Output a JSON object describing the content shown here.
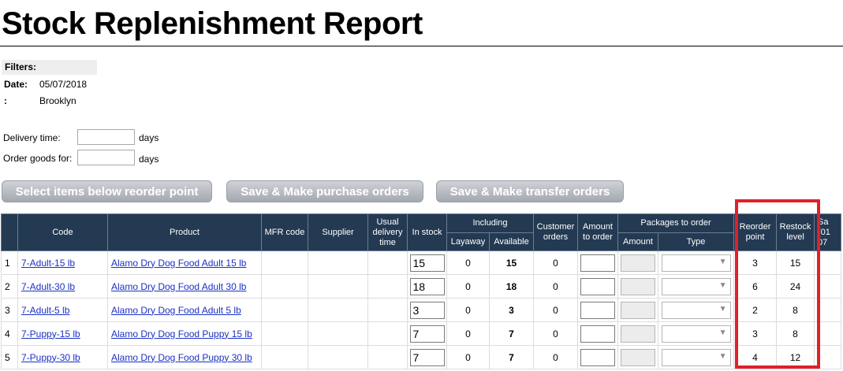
{
  "page_title": "Stock Replenishment Report",
  "filters": {
    "heading": "Filters:",
    "date_label": "Date:",
    "date_value": "05/07/2018",
    "location_label": ":",
    "location_value": "Brooklyn"
  },
  "options": {
    "delivery_label": "Delivery time:",
    "delivery_unit": "days",
    "order_label": "Order goods for:",
    "order_unit": "days"
  },
  "buttons": {
    "select_below": "Select items below reorder point",
    "purchase": "Save & Make purchase orders",
    "transfer": "Save & Make transfer orders"
  },
  "table": {
    "headers": {
      "code": "Code",
      "product": "Product",
      "mfr": "MFR code",
      "supplier": "Supplier",
      "usual_delivery": "Usual delivery time",
      "in_stock": "In stock",
      "including": "Including",
      "layaway": "Layaway",
      "available": "Available",
      "customer_orders": "Customer orders",
      "amount_to_order": "Amount to order",
      "packages": "Packages to order",
      "pkg_amount": "Amount",
      "pkg_type": "Type",
      "reorder_point": "Reorder point",
      "restock_level": "Restock level",
      "cut_col_1": "Sa",
      "cut_col_2": "(01",
      "cut_col_3": "07"
    },
    "rows": [
      {
        "n": "1",
        "code": "7-Adult-15 lb",
        "product": "Alamo Dry Dog Food Adult 15 lb",
        "in_stock": "15",
        "layaway": "0",
        "available": "15",
        "customer_orders": "0",
        "reorder": "3",
        "restock": "15"
      },
      {
        "n": "2",
        "code": "7-Adult-30 lb",
        "product": "Alamo Dry Dog Food Adult 30 lb",
        "in_stock": "18",
        "layaway": "0",
        "available": "18",
        "customer_orders": "0",
        "reorder": "6",
        "restock": "24"
      },
      {
        "n": "3",
        "code": "7-Adult-5 lb",
        "product": "Alamo Dry Dog Food Adult 5 lb",
        "in_stock": "3",
        "layaway": "0",
        "available": "3",
        "customer_orders": "0",
        "reorder": "2",
        "restock": "8"
      },
      {
        "n": "4",
        "code": "7-Puppy-15 lb",
        "product": "Alamo Dry Dog Food Puppy 15 lb",
        "in_stock": "7",
        "layaway": "0",
        "available": "7",
        "customer_orders": "0",
        "reorder": "3",
        "restock": "8"
      },
      {
        "n": "5",
        "code": "7-Puppy-30 lb",
        "product": "Alamo Dry Dog Food Puppy 30 lb",
        "in_stock": "7",
        "layaway": "0",
        "available": "7",
        "customer_orders": "0",
        "reorder": "4",
        "restock": "12"
      }
    ]
  },
  "highlight_color": "#e0202a",
  "header_color": "#233a52",
  "link_color": "#1a31c4",
  "dropdown_icon": "chevron-down-icon"
}
